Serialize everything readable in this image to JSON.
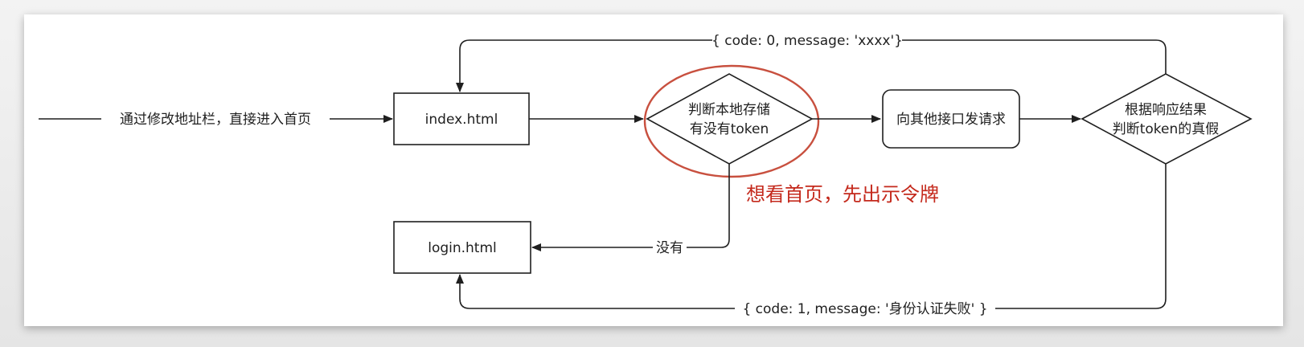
{
  "nodes": {
    "entry_label": "通过修改地址栏，直接进入首页",
    "index": "index.html",
    "check_line1": "判断本地存储",
    "check_line2": "有没有token",
    "request": "向其他接口发请求",
    "judge_line1": "根据响应结果",
    "judge_line2": "判断token的真假",
    "login": "login.html"
  },
  "edges": {
    "success": "{ code: 0, message: 'xxxx'}",
    "none": "没有",
    "fail": "{ code: 1, message: '身份认证失败' }"
  },
  "annotation": {
    "text": "想看首页，先出示令牌",
    "color": "#c4291c"
  }
}
